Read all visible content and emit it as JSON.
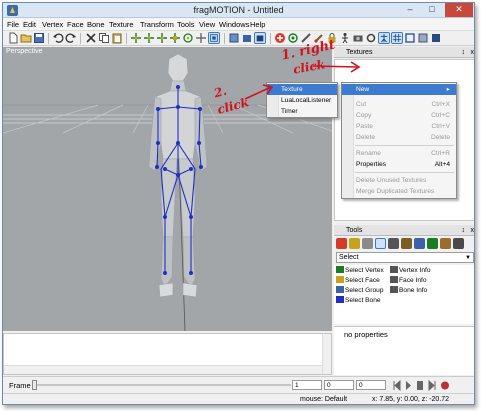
{
  "window": {
    "title": "fragMOTION - Untitled",
    "controls": {
      "minimize": "–",
      "maximize": "□",
      "close": "✕"
    }
  },
  "menubar": [
    "File",
    "Edit",
    "Vertex",
    "Face",
    "Bone",
    "Texture",
    "Transform",
    "Tools",
    "View",
    "Windows",
    "Help"
  ],
  "viewport": {
    "label": "Perspective",
    "background": "#a3a6a9"
  },
  "textures_panel": {
    "title": "Textures",
    "pin": "↕",
    "close": "x"
  },
  "tools_panel": {
    "title": "Tools",
    "select_value": "Select",
    "items": [
      {
        "label": "Select Vertex",
        "icon": "vertex-select-icon"
      },
      {
        "label": "Vertex Info",
        "icon": "vertex-info-icon"
      },
      {
        "label": "Select Face",
        "icon": "face-select-icon"
      },
      {
        "label": "Face Info",
        "icon": "face-info-icon"
      },
      {
        "label": "Select Group",
        "icon": "group-select-icon"
      },
      {
        "label": "Bone Info",
        "icon": "bone-info-icon"
      },
      {
        "label": "Select Bone",
        "icon": "bone-select-icon"
      }
    ]
  },
  "properties_panel": {
    "text": "no properties"
  },
  "context_menu": {
    "items": [
      {
        "label": "New",
        "shortcut": "",
        "highlighted": true,
        "disabled": false,
        "submenu": true
      },
      {
        "label": "Cut",
        "shortcut": "Ctrl+X",
        "disabled": true
      },
      {
        "label": "Copy",
        "shortcut": "Ctrl+C",
        "disabled": true
      },
      {
        "label": "Paste",
        "shortcut": "Ctrl+V",
        "disabled": true
      },
      {
        "label": "Delete",
        "shortcut": "Delete",
        "disabled": true
      },
      {
        "label": "Rename",
        "shortcut": "Ctrl+R",
        "disabled": true
      },
      {
        "label": "Properties",
        "shortcut": "Alt+4",
        "disabled": false
      },
      {
        "label": "Delete Unused Textures",
        "shortcut": "",
        "disabled": true
      },
      {
        "label": "Merge Duplicated Textures",
        "shortcut": "",
        "disabled": true
      }
    ],
    "submenu": [
      {
        "label": "Texture",
        "highlighted": true
      },
      {
        "label": "LuaLocalListener",
        "highlighted": false
      },
      {
        "label": "Timer",
        "highlighted": false
      }
    ]
  },
  "annotations": {
    "step1_line1": "1. right",
    "step1_line2": "click",
    "step2_line1": "2.",
    "step2_line2": "click"
  },
  "frame_bar": {
    "label": "Frame",
    "fields": [
      "1",
      "0",
      "0"
    ]
  },
  "status_bar": {
    "mode": "mouse: Default",
    "coords": "x: 7.85, y: 0.00, z: -20.72"
  },
  "colors": {
    "accent": "#3d7bd1",
    "annotation": "#d1121c",
    "skeleton": "#1f2fc4"
  }
}
